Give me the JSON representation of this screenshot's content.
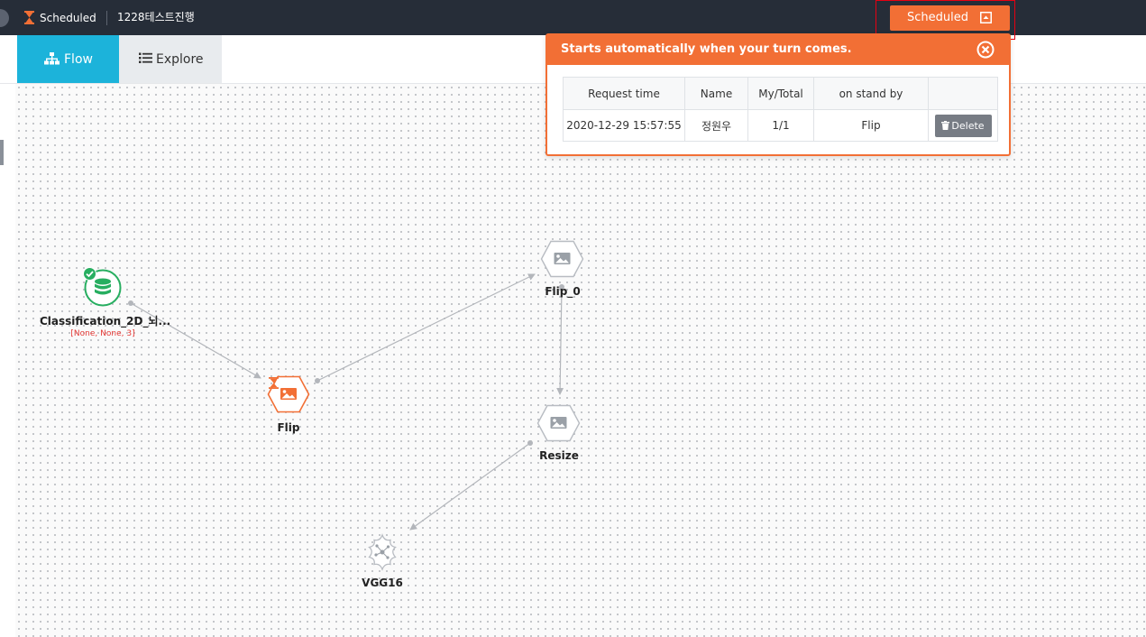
{
  "topbar": {
    "status_label": "Scheduled",
    "project_name": "1228테스트진행",
    "scheduled_button_label": "Scheduled"
  },
  "tabs": [
    {
      "label": "Flow",
      "active": true,
      "icon": "sitemap-icon"
    },
    {
      "label": "Explore",
      "active": false,
      "icon": "list-icon"
    }
  ],
  "popup": {
    "title": "Starts automatically when your turn comes.",
    "columns": [
      "Request time",
      "Name",
      "My/Total",
      "on stand by",
      ""
    ],
    "rows": [
      {
        "request_time": "2020-12-29 15:57:55",
        "name": "정원우",
        "my_total": "1/1",
        "on_stand_by": "Flip",
        "action": "Delete"
      }
    ]
  },
  "nodes": [
    {
      "id": "classification",
      "label": "Classification_2D_뇌...",
      "sublabel": "[None, None, 3]",
      "type": "dataset",
      "status": "done"
    },
    {
      "id": "flip",
      "label": "Flip",
      "type": "image-op",
      "status": "scheduled"
    },
    {
      "id": "flip0",
      "label": "Flip_0",
      "type": "image-op",
      "status": "idle"
    },
    {
      "id": "resize",
      "label": "Resize",
      "type": "image-op",
      "status": "idle"
    },
    {
      "id": "vgg16",
      "label": "VGG16",
      "type": "model",
      "status": "idle"
    }
  ],
  "colors": {
    "accent_orange": "#f26f35",
    "tab_active": "#1cb3da",
    "topbar_bg": "#262d38",
    "dataset_green": "#27ae60",
    "error_red": "#e53935",
    "highlight_box": "#e60012"
  }
}
